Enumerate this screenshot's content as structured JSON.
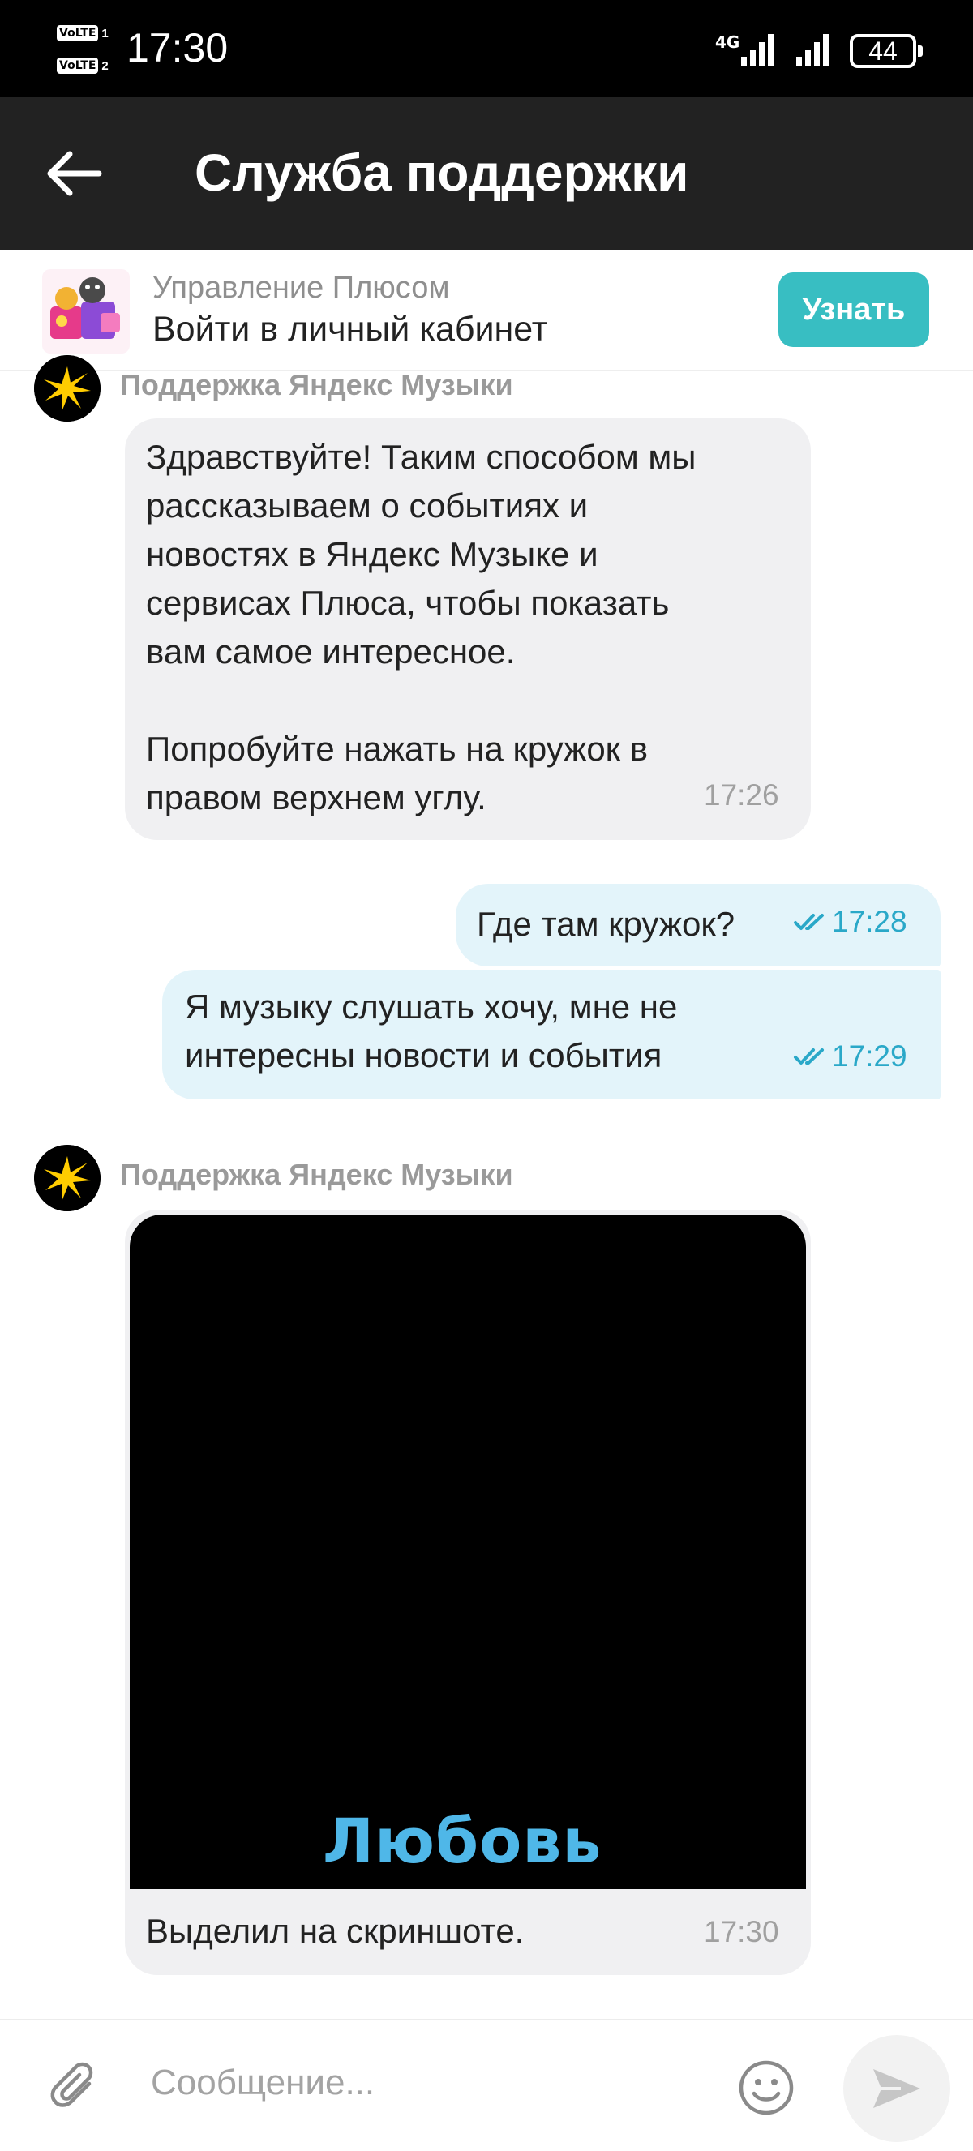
{
  "status_bar": {
    "sim1": "VoLTE",
    "sim1_slot": "1",
    "sim2": "VoLTE",
    "sim2_slot": "2",
    "time": "17:30",
    "network": "4G",
    "battery": "44"
  },
  "app_bar": {
    "title": "Служба поддержки",
    "back_icon": "arrow-left-icon"
  },
  "promo": {
    "subtitle": "Управление Плюсом",
    "title": "Войти в личный кабинет",
    "button": "Узнать",
    "accent_color": "#38bec2"
  },
  "messages": [
    {
      "direction": "in",
      "sender": "Поддержка Яндекс Музыки",
      "text": "Здравствуйте! Таким способом мы\nрассказываем о событиях и\nновостях в Яндекс Музыке и\nсервисах Плюса, чтобы показать\nвам самое интересное.\n\nПопробуйте нажать на кружок в\nправом верхнем углу.",
      "time": "17:26"
    },
    {
      "direction": "out",
      "text": "Где там кружок?",
      "time": "17:28",
      "status": "read"
    },
    {
      "direction": "out",
      "text": "Я музыку слушать хочу, мне не\nинтересны новости и события",
      "time": "17:29",
      "status": "read"
    },
    {
      "direction": "in",
      "sender": "Поддержка Яндекс Музыки",
      "image_text": "Любовь",
      "text": "Выделил на скриншоте.",
      "time": "17:30"
    }
  ],
  "composer": {
    "placeholder": "Сообщение...",
    "attach_icon": "paperclip-icon",
    "emoji_icon": "smiley-icon",
    "send_icon": "send-icon"
  }
}
